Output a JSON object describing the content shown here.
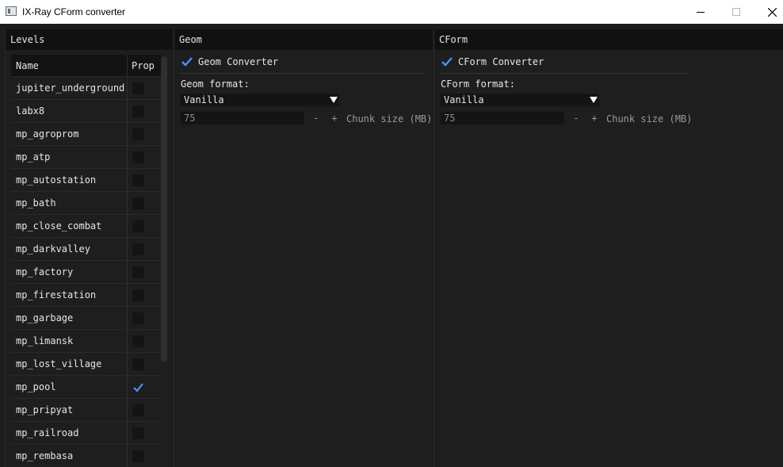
{
  "window": {
    "title": "IX-Ray CForm converter"
  },
  "levels": {
    "header": "Levels",
    "columns": {
      "name": "Name",
      "prop": "Prop"
    },
    "rows": [
      {
        "name": "jupiter_underground",
        "checked": false
      },
      {
        "name": "labx8",
        "checked": false
      },
      {
        "name": "mp_agroprom",
        "checked": false
      },
      {
        "name": "mp_atp",
        "checked": false
      },
      {
        "name": "mp_autostation",
        "checked": false
      },
      {
        "name": "mp_bath",
        "checked": false
      },
      {
        "name": "mp_close_combat",
        "checked": false
      },
      {
        "name": "mp_darkvalley",
        "checked": false
      },
      {
        "name": "mp_factory",
        "checked": false
      },
      {
        "name": "mp_firestation",
        "checked": false
      },
      {
        "name": "mp_garbage",
        "checked": false
      },
      {
        "name": "mp_limansk",
        "checked": false
      },
      {
        "name": "mp_lost_village",
        "checked": false
      },
      {
        "name": "mp_pool",
        "checked": true
      },
      {
        "name": "mp_pripyat",
        "checked": false
      },
      {
        "name": "mp_railroad",
        "checked": false
      },
      {
        "name": "mp_rembasa",
        "checked": false
      }
    ]
  },
  "geom": {
    "header": "Geom",
    "converter_label": "Geom Converter",
    "converter_enabled": true,
    "format_label": "Geom format:",
    "format_value": "Vanilla",
    "chunk_value": "75",
    "minus": "-",
    "plus": "+",
    "chunk_label": "Chunk size (MB)"
  },
  "cform": {
    "header": "CForm",
    "converter_label": "CForm Converter",
    "converter_enabled": true,
    "format_label": "CForm format:",
    "format_value": "Vanilla",
    "chunk_value": "75",
    "minus": "-",
    "plus": "+",
    "chunk_label": "Chunk size (MB)"
  },
  "colors": {
    "accent_check": "#4296fa",
    "background": "#1c1c1c",
    "header_bg": "#111111",
    "frame_bg": "#141414"
  }
}
